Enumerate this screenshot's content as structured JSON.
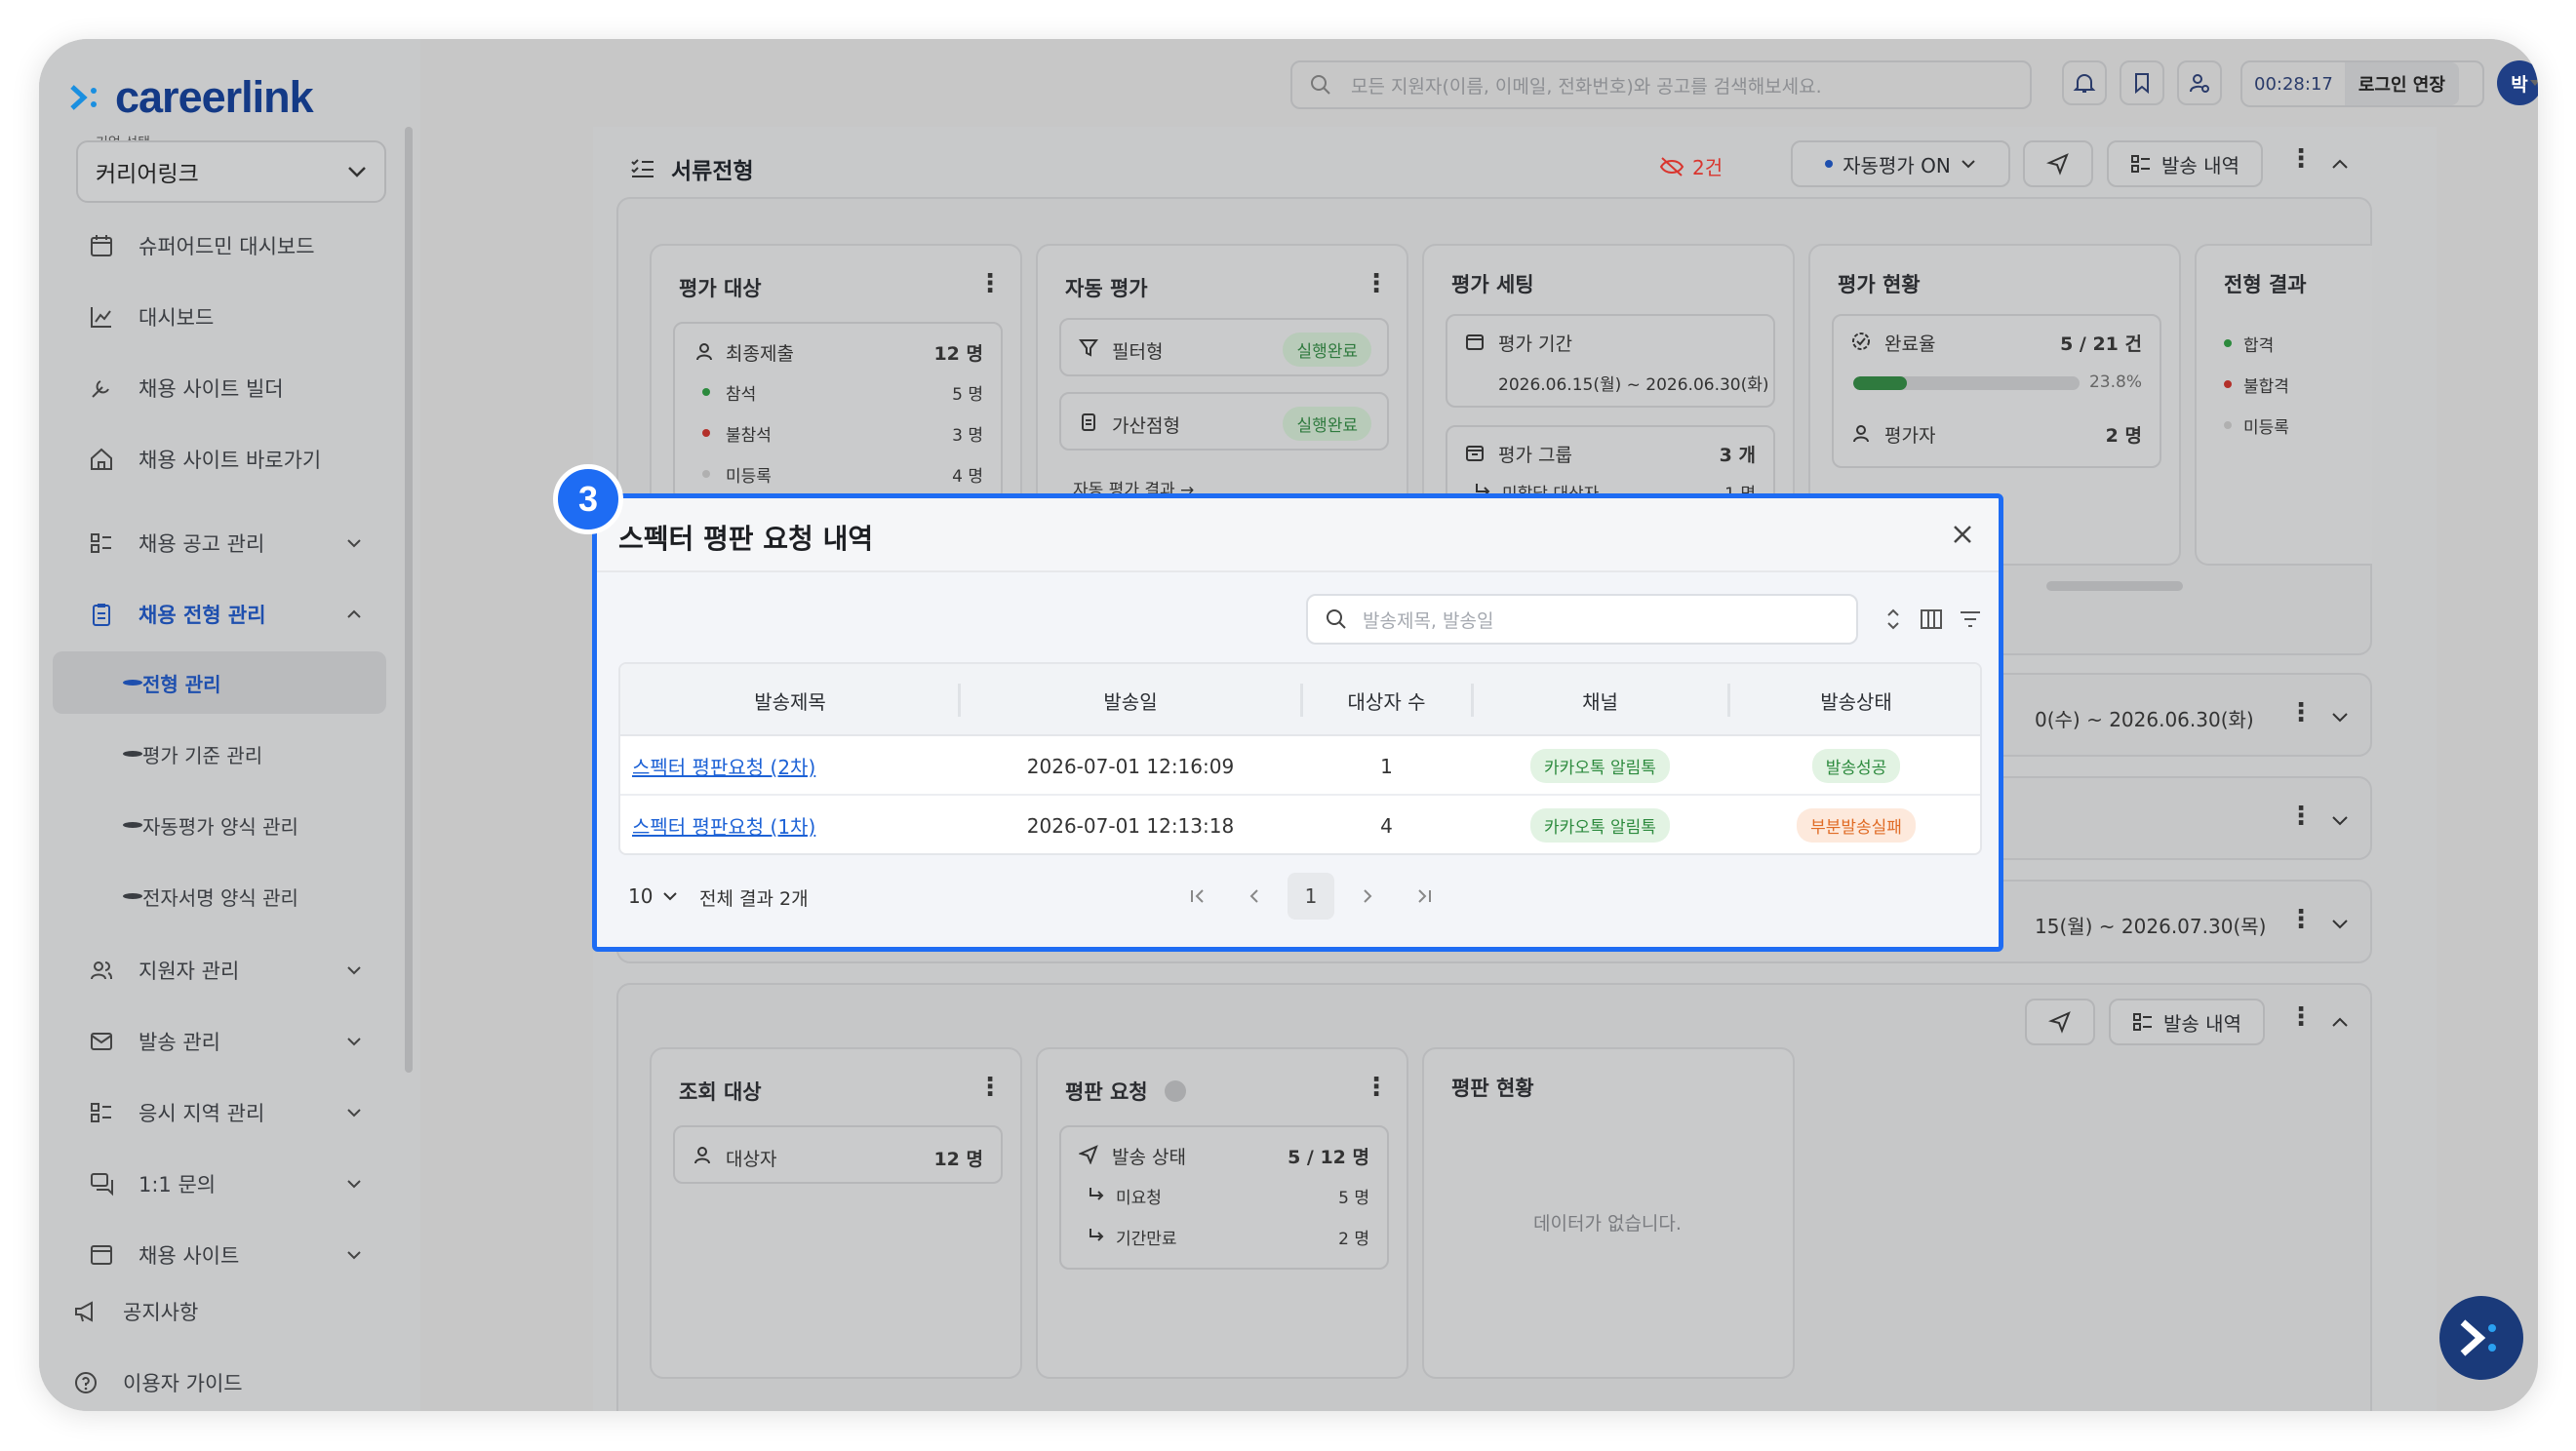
{
  "app": {
    "logo_text": "careerlink"
  },
  "sidebar": {
    "company_label": "기업 선택",
    "company_value": "커리어링크",
    "items": [
      {
        "label": "슈퍼어드민 대시보드",
        "icon": "calendar-icon"
      },
      {
        "label": "대시보드",
        "icon": "chart-icon"
      },
      {
        "label": "채용 사이트 빌더",
        "icon": "tools-icon"
      },
      {
        "label": "채용 사이트 바로가기",
        "icon": "home-icon"
      },
      {
        "label": "채용 공고 관리",
        "icon": "list-icon"
      },
      {
        "label": "채용 전형 관리",
        "icon": "clipboard-icon"
      },
      {
        "label": "지원자 관리",
        "icon": "users-icon"
      },
      {
        "label": "발송 관리",
        "icon": "mail-icon"
      },
      {
        "label": "응시 지역 관리",
        "icon": "list-icon"
      },
      {
        "label": "1:1 문의",
        "icon": "chat-icon"
      },
      {
        "label": "채용 사이트",
        "icon": "browser-icon"
      }
    ],
    "sub_items": [
      "전형 관리",
      "평가 기준 관리",
      "자동평가 양식 관리",
      "전자서명 양식 관리"
    ],
    "bottom": [
      "공지사항",
      "이용자 가이드"
    ]
  },
  "topbar": {
    "search_placeholder": "모든 지원자(이름, 이메일, 전화번호)와 공고를 검색해보세요.",
    "timer": "00:28:17",
    "extend_label": "로그인 연장",
    "avatar": "박"
  },
  "stage1": {
    "title": "서류전형",
    "hidden_count": "2건",
    "auto_eval": "자동평가 ON",
    "history_label": "발송 내역",
    "cards": {
      "target": {
        "title": "평가 대상",
        "final": "최종제출",
        "final_v": "12 명",
        "attend": "참석",
        "attend_v": "5 명",
        "absent": "불참석",
        "absent_v": "3 명",
        "unreg": "미등록",
        "unreg_v": "4 명"
      },
      "auto": {
        "title": "자동 평가",
        "filter": "필터형",
        "filter_s": "실행완료",
        "score": "가산점형",
        "score_s": "실행완료",
        "result_link": "자동 평가 결과 →"
      },
      "setting": {
        "title": "평가 세팅",
        "period_l": "평가 기간",
        "period_v": "2026.06.15(월) ~ 2026.06.30(화)",
        "group_l": "평가 그룹",
        "group_v": "3 개",
        "unassigned_l": "미할당 대상자",
        "unassigned_v": "1 명"
      },
      "status": {
        "title": "평가 현황",
        "rate_l": "완료율",
        "rate_v": "5 / 21 건",
        "rate_pct": "23.8%",
        "rate_fill": 0.238,
        "evaluator_l": "평가자",
        "evaluator_v": "2 명"
      },
      "result": {
        "title": "전형 결과",
        "pass": "합격",
        "fail": "불합격",
        "unreg": "미등록"
      }
    }
  },
  "collapsed_rows": [
    {
      "period": "0(수) ~ 2026.06.30(화)"
    },
    {
      "period": ""
    },
    {
      "period": "15(월) ~ 2026.07.30(목)"
    }
  ],
  "stage_ref": {
    "history_label": "발송 내역",
    "cards": {
      "target": {
        "title": "조회 대상",
        "row_l": "대상자",
        "row_v": "12 명"
      },
      "request": {
        "title": "평판 요청",
        "send_l": "발송 상태",
        "send_v": "5 / 12 명",
        "pending_l": "미요청",
        "pending_v": "5 명",
        "expired_l": "기간만료",
        "expired_v": "2 명"
      },
      "status": {
        "title": "평판 현황",
        "empty": "데이터가 없습니다."
      }
    }
  },
  "modal": {
    "step": "3",
    "title": "스펙터 평판 요청 내역",
    "search_placeholder": "발송제목, 발송일",
    "columns": [
      "발송제목",
      "발송일",
      "대상자 수",
      "채널",
      "발송상태"
    ],
    "rows": [
      {
        "title": "스펙터 평판요청 (2차)",
        "date": "2026-07-01 12:16:09",
        "count": "1",
        "channel": "카카오톡 알림톡",
        "status": "발송성공"
      },
      {
        "title": "스펙터 평판요청 (1차)",
        "date": "2026-07-01 12:13:18",
        "count": "4",
        "channel": "카카오톡 알림톡",
        "status": "부분발송실패"
      }
    ],
    "page_size": "10",
    "total": "전체 결과 2개",
    "current_page": "1"
  },
  "colors": {
    "accent": "#1e6cf3",
    "brand": "#143a86",
    "success": "#2c8a3d",
    "warning": "#e06b25"
  }
}
